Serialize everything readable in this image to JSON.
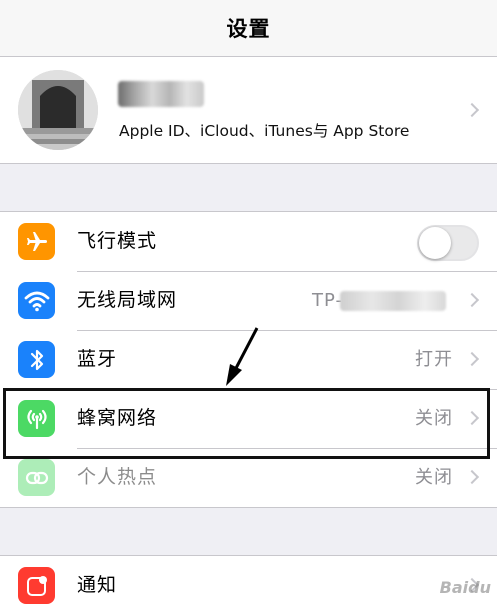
{
  "navbar": {
    "title": "设置"
  },
  "profile": {
    "subtitle": "Apple ID、iCloud、iTunes与 App Store"
  },
  "settings": [
    {
      "label": "飞行模式",
      "icon": "airplane-icon",
      "color": "#ff9500",
      "control": "toggle",
      "toggle_on": false
    },
    {
      "label": "无线局域网",
      "icon": "wifi-icon",
      "color": "#1a82fb",
      "value": "TP-"
    },
    {
      "label": "蓝牙",
      "icon": "bluetooth-icon",
      "color": "#1a82fb",
      "value": "打开"
    },
    {
      "label": "蜂窝网络",
      "icon": "cellular-icon",
      "color": "#4cd964",
      "value": "关闭"
    },
    {
      "label": "个人热点",
      "icon": "hotspot-icon",
      "color": "#4cd964",
      "value": "关闭"
    }
  ],
  "notifications": {
    "label": "通知",
    "icon": "notifications-icon",
    "color": "#ff3b30"
  },
  "watermark": "Baidu"
}
